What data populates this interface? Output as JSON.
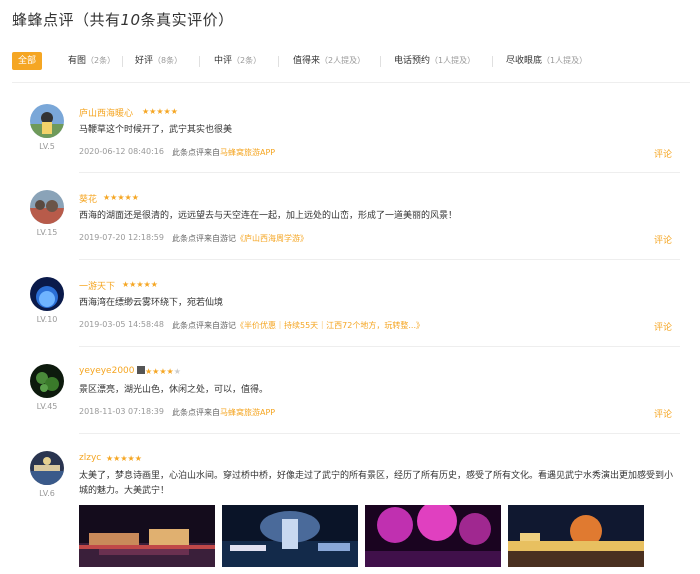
{
  "page": {
    "title_prefix": "蜂蜂点评（共有",
    "title_count": "10",
    "title_suffix": "条真实评价）"
  },
  "tabs": [
    {
      "label": "全部",
      "count": ""
    },
    {
      "label": "有图",
      "count": "（2条）"
    },
    {
      "label": "好评",
      "count": "（8条）"
    },
    {
      "label": "中评",
      "count": "（2条）"
    },
    {
      "label": "值得来",
      "count": "（2人提及）"
    },
    {
      "label": "电话预约",
      "count": "（1人提及）"
    },
    {
      "label": "尽收眼底",
      "count": "（1人提及）"
    }
  ],
  "reviews": [
    {
      "user": "庐山西海暖心",
      "level": "LV.5",
      "rating": 5,
      "content": "马鞭草这个时候开了，武宁其实也很美",
      "time": "2020-06-12 08:40:16",
      "source_prefix": "此条点评来自",
      "source_link": "马蜂窝旅游APP",
      "reply": "评论"
    },
    {
      "user": "葵花",
      "level": "LV.15",
      "rating": 5,
      "content": "西海的湖面还是很清的，远远望去与天空连在一起，加上远处的山峦，形成了一道美丽的风景！",
      "time": "2019-07-20 12:18:59",
      "source_prefix": "此条点评来自游记",
      "source_link": "《庐山西海周学游》",
      "reply": "评论"
    },
    {
      "user": "一游天下",
      "level": "LV.10",
      "rating": 5,
      "content": "西海湾在缥缈云雾环绕下，宛若仙境",
      "time": "2019-03-05 14:58:48",
      "source_prefix": "此条点评来自游记",
      "source_link": "《半价优惠｜持续55天｜江西72个地方，玩转整...》",
      "reply": "评论"
    },
    {
      "user": "yeyeye2000",
      "level": "LV.45",
      "rating": 4,
      "content": "景区漂亮，湖光山色，休闲之处，可以，值得。",
      "time": "2018-11-03 07:18:39",
      "source_prefix": "此条点评来自",
      "source_link": "马蜂窝旅游APP",
      "reply": "评论"
    },
    {
      "user": "zlzyc",
      "level": "LV.6",
      "rating": 5,
      "content": "太美了，梦息诗画里，心泊山水间。穿过桥中桥，好像走过了武宁的所有景区，经历了所有历史，感受了所有文化。看遇见武宁水秀演出更加感受到小城的魅力。大美武宁！",
      "photos": [
        "night-show-photo",
        "fountain-photo",
        "purple-lights-photo",
        "lantern-photo"
      ]
    }
  ],
  "colors": {
    "accent": "#f5a623",
    "muted": "#999999"
  }
}
